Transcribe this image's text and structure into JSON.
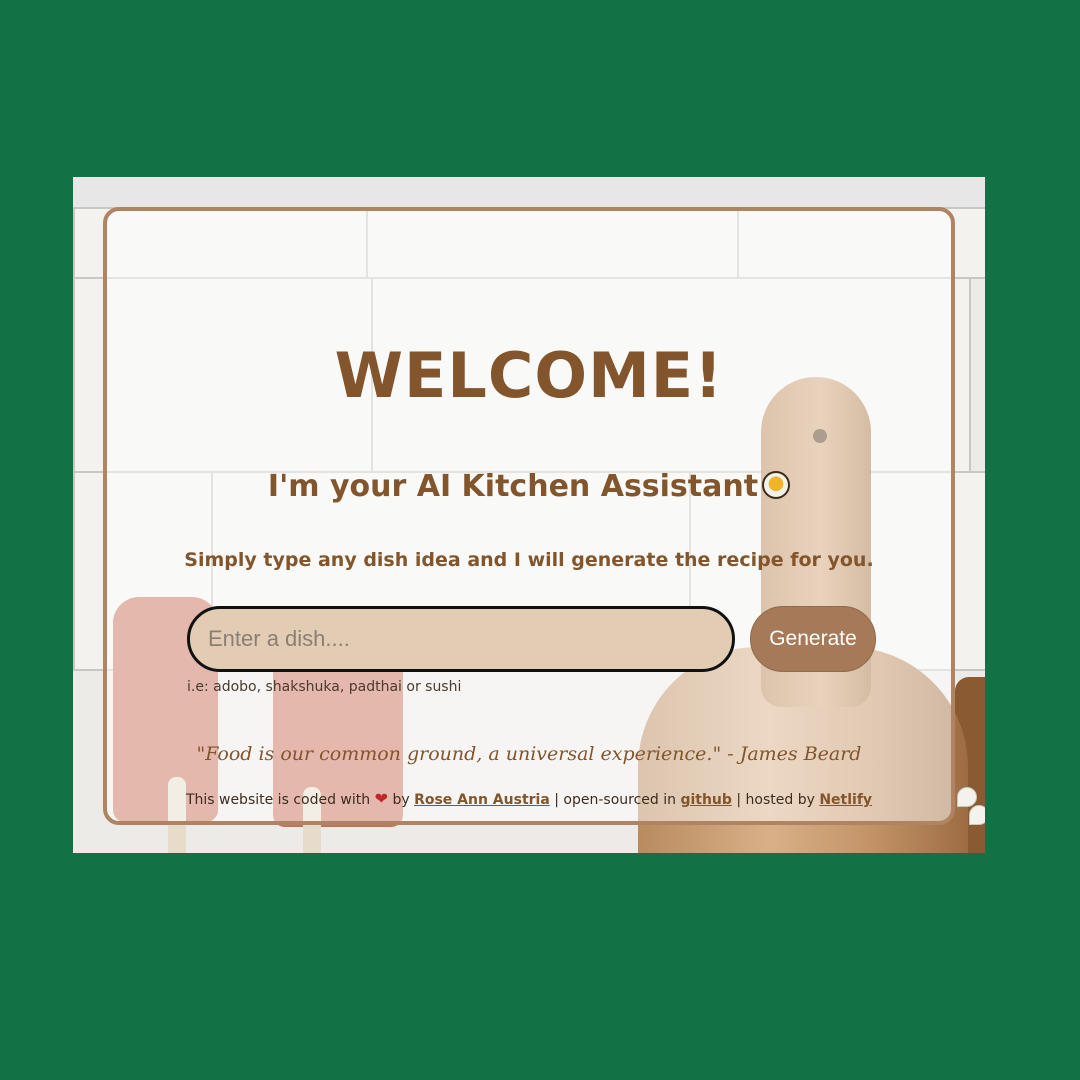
{
  "page": {
    "background_color": "#127245",
    "accent_color": "#82552c",
    "card_border_color": "#b08462"
  },
  "hero": {
    "title": "WELCOME!",
    "subtitle": "I'm your AI Kitchen Assistant",
    "subtitle_icon": "soup-bowl-icon",
    "tagline": "Simply type any dish idea and I will generate the recipe for you."
  },
  "search": {
    "placeholder": "Enter a dish....",
    "value": "",
    "button_label": "Generate",
    "hint": "i.e: adobo, shakshuka, padthai or sushi"
  },
  "quote": {
    "text": "\"Food is our common ground, a universal experience.\" - James Beard"
  },
  "footer": {
    "prefix": "This website is coded with",
    "heart_icon": "heart-icon",
    "by": "by",
    "author": "Rose Ann Austria",
    "separator1": "| open-sourced in",
    "repo": "github",
    "separator2": "| hosted by",
    "host": "Netlify"
  }
}
